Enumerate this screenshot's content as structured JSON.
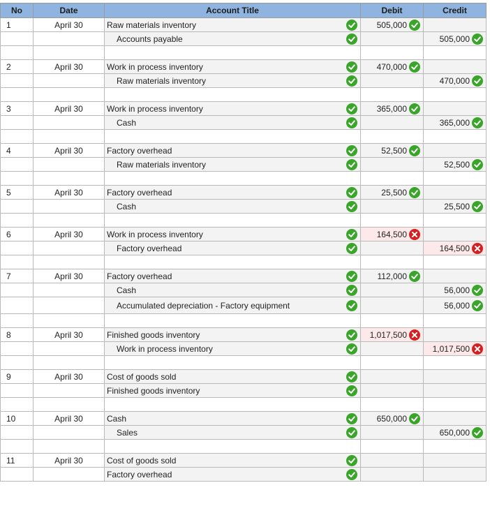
{
  "headers": {
    "no": "No",
    "date": "Date",
    "account": "Account Title",
    "debit": "Debit",
    "credit": "Credit"
  },
  "entries": [
    {
      "no": "1",
      "date": "April 30",
      "lines": [
        {
          "account": "Raw materials inventory",
          "indent": false,
          "account_status": "correct",
          "debit": "505,000",
          "debit_status": "correct",
          "credit": "",
          "credit_status": ""
        },
        {
          "account": "Accounts payable",
          "indent": true,
          "account_status": "correct",
          "debit": "",
          "debit_status": "",
          "credit": "505,000",
          "credit_status": "correct"
        }
      ]
    },
    {
      "no": "2",
      "date": "April 30",
      "lines": [
        {
          "account": "Work in process inventory",
          "indent": false,
          "account_status": "correct",
          "debit": "470,000",
          "debit_status": "correct",
          "credit": "",
          "credit_status": ""
        },
        {
          "account": "Raw materials inventory",
          "indent": true,
          "account_status": "correct",
          "debit": "",
          "debit_status": "",
          "credit": "470,000",
          "credit_status": "correct"
        }
      ]
    },
    {
      "no": "3",
      "date": "April 30",
      "lines": [
        {
          "account": "Work in process inventory",
          "indent": false,
          "account_status": "correct",
          "debit": "365,000",
          "debit_status": "correct",
          "credit": "",
          "credit_status": ""
        },
        {
          "account": "Cash",
          "indent": true,
          "account_status": "correct",
          "debit": "",
          "debit_status": "",
          "credit": "365,000",
          "credit_status": "correct"
        }
      ]
    },
    {
      "no": "4",
      "date": "April 30",
      "lines": [
        {
          "account": "Factory overhead",
          "indent": false,
          "account_status": "correct",
          "debit": "52,500",
          "debit_status": "correct",
          "credit": "",
          "credit_status": ""
        },
        {
          "account": "Raw materials inventory",
          "indent": true,
          "account_status": "correct",
          "debit": "",
          "debit_status": "",
          "credit": "52,500",
          "credit_status": "correct"
        }
      ]
    },
    {
      "no": "5",
      "date": "April 30",
      "lines": [
        {
          "account": "Factory overhead",
          "indent": false,
          "account_status": "correct",
          "debit": "25,500",
          "debit_status": "correct",
          "credit": "",
          "credit_status": ""
        },
        {
          "account": "Cash",
          "indent": true,
          "account_status": "correct",
          "debit": "",
          "debit_status": "",
          "credit": "25,500",
          "credit_status": "correct"
        }
      ]
    },
    {
      "no": "6",
      "date": "April 30",
      "lines": [
        {
          "account": "Work in process inventory",
          "indent": false,
          "account_status": "correct",
          "debit": "164,500",
          "debit_status": "incorrect",
          "credit": "",
          "credit_status": ""
        },
        {
          "account": "Factory overhead",
          "indent": true,
          "account_status": "correct",
          "debit": "",
          "debit_status": "",
          "credit": "164,500",
          "credit_status": "incorrect"
        }
      ]
    },
    {
      "no": "7",
      "date": "April 30",
      "lines": [
        {
          "account": "Factory overhead",
          "indent": false,
          "account_status": "correct",
          "debit": "112,000",
          "debit_status": "correct",
          "credit": "",
          "credit_status": ""
        },
        {
          "account": "Cash",
          "indent": true,
          "account_status": "correct",
          "debit": "",
          "debit_status": "",
          "credit": "56,000",
          "credit_status": "correct"
        },
        {
          "account": "Accumulated depreciation - Factory equipment",
          "indent": true,
          "account_status": "correct",
          "debit": "",
          "debit_status": "",
          "credit": "56,000",
          "credit_status": "correct"
        }
      ]
    },
    {
      "no": "8",
      "date": "April 30",
      "lines": [
        {
          "account": "Finished goods inventory",
          "indent": false,
          "account_status": "correct",
          "debit": "1,017,500",
          "debit_status": "incorrect",
          "credit": "",
          "credit_status": ""
        },
        {
          "account": "Work in process inventory",
          "indent": true,
          "account_status": "correct",
          "debit": "",
          "debit_status": "",
          "credit": "1,017,500",
          "credit_status": "incorrect"
        }
      ]
    },
    {
      "no": "9",
      "date": "April 30",
      "lines": [
        {
          "account": "Cost of goods sold",
          "indent": false,
          "account_status": "correct",
          "debit": "",
          "debit_status": "",
          "credit": "",
          "credit_status": ""
        },
        {
          "account": "Finished goods inventory",
          "indent": false,
          "account_status": "correct",
          "debit": "",
          "debit_status": "",
          "credit": "",
          "credit_status": ""
        }
      ]
    },
    {
      "no": "10",
      "date": "April 30",
      "lines": [
        {
          "account": "Cash",
          "indent": false,
          "account_status": "correct",
          "debit": "650,000",
          "debit_status": "correct",
          "credit": "",
          "credit_status": ""
        },
        {
          "account": "Sales",
          "indent": true,
          "account_status": "correct",
          "debit": "",
          "debit_status": "",
          "credit": "650,000",
          "credit_status": "correct"
        }
      ]
    },
    {
      "no": "11",
      "date": "April 30",
      "lines": [
        {
          "account": "Cost of goods sold",
          "indent": false,
          "account_status": "correct",
          "debit": "",
          "debit_status": "",
          "credit": "",
          "credit_status": ""
        },
        {
          "account": "Factory overhead",
          "indent": false,
          "account_status": "correct",
          "debit": "",
          "debit_status": "",
          "credit": "",
          "credit_status": ""
        }
      ]
    }
  ],
  "icons": {
    "correct": "check-circle-icon",
    "incorrect": "x-circle-icon"
  },
  "colors": {
    "header_bg": "#8fb4df",
    "correct": "#3aa52a",
    "incorrect": "#d42020",
    "incorrect_cell_bg": "#fde9e9"
  }
}
